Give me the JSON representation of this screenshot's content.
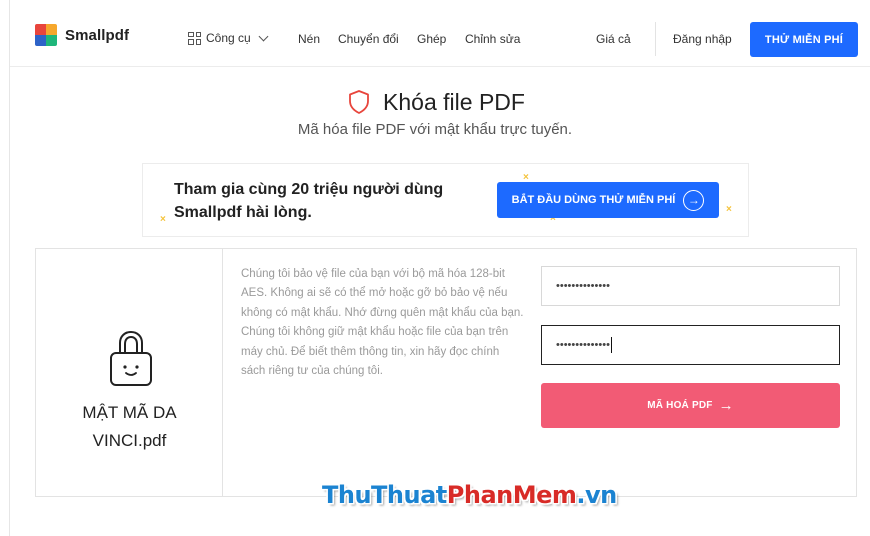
{
  "brand": {
    "name": "Smallpdf"
  },
  "nav": {
    "tools_label": "Công cụ",
    "compress": "Nén",
    "convert": "Chuyển đổi",
    "merge": "Ghép",
    "edit": "Chỉnh sửa",
    "pricing": "Giá cả",
    "login": "Đăng nhập",
    "free_trial": "THỬ MIỄN PHÍ"
  },
  "page": {
    "title": "Khóa file PDF",
    "subtitle": "Mã hóa file PDF với mật khẩu trực tuyến."
  },
  "promo": {
    "line1": "Tham gia cùng 20 triệu người dùng",
    "line2": "Smallpdf hài lòng.",
    "button": "BẮT ĐẦU DÙNG THỬ MIỄN PHÍ"
  },
  "file": {
    "name_line1": "MẬT MÃ DA",
    "name_line2": "VINCI.pdf"
  },
  "description": {
    "p1": "Chúng tôi bảo vệ file của bạn với bộ mã hóa 128-bit AES. Không ai sẽ có thể mở hoặc gỡ bỏ bảo vệ nếu không có mật khẩu. Nhớ đừng quên mật khẩu của bạn.",
    "p2": "Chúng tôi không giữ mật khẩu hoặc file của bạn trên máy chủ. Để biết thêm thông tin, xin hãy đọc chính sách riêng tư của chúng tôi."
  },
  "form": {
    "password_value": "••••••••••••••",
    "confirm_value": "••••••••••••••",
    "encrypt_button": "MÃ HOÁ PDF"
  },
  "watermark": {
    "part1": "ThuThuat",
    "part2": "PhanMem",
    "part3": ".vn"
  },
  "colors": {
    "primary": "#1d6aff",
    "encrypt": "#f25b75",
    "shield": "#e8453c"
  }
}
